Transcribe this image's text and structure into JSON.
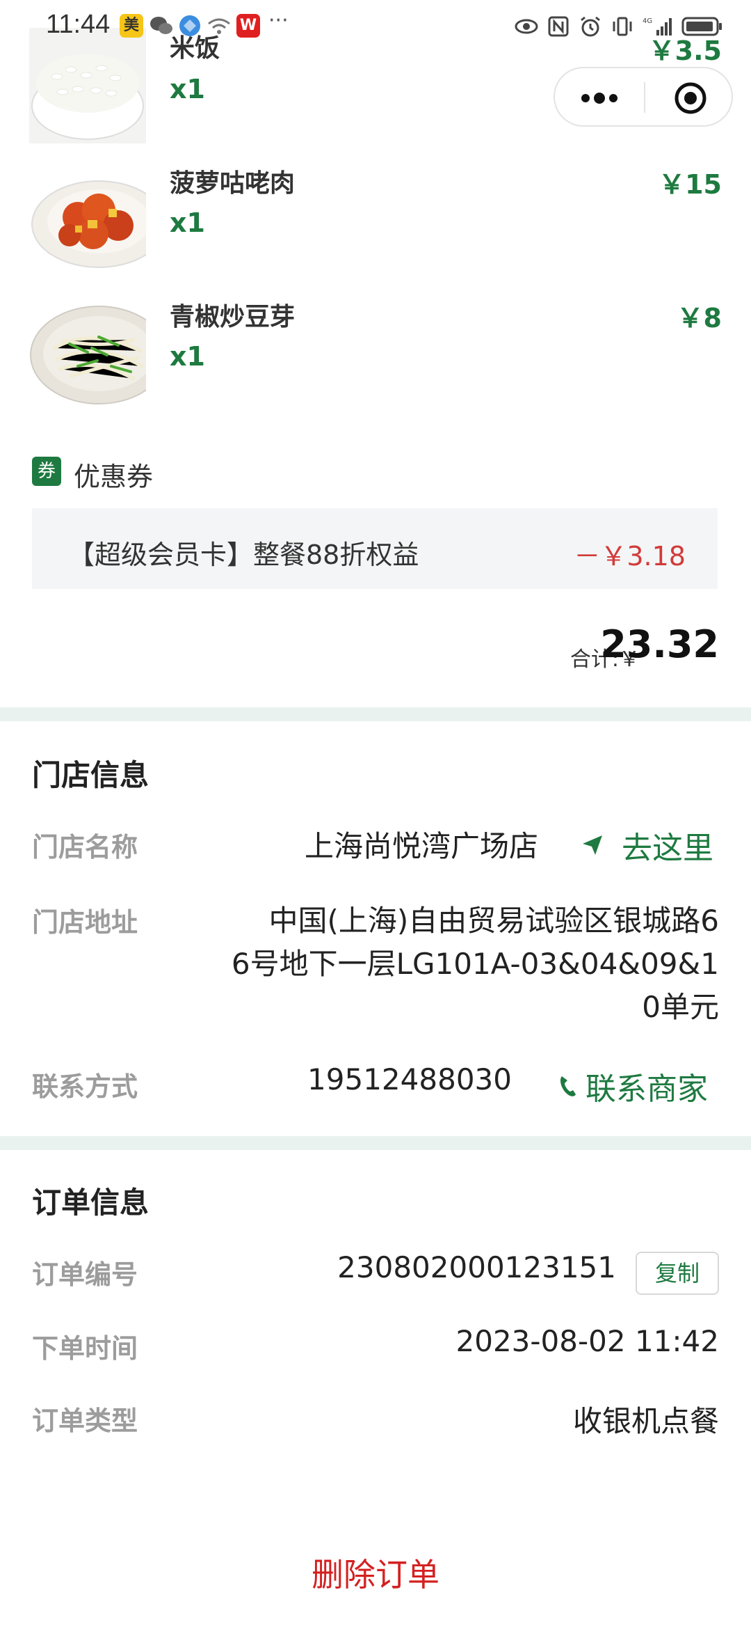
{
  "status_bar": {
    "time": "11:44",
    "app_badge_1": "美",
    "app_badge_2": "W",
    "more": "···",
    "network": "4G"
  },
  "items": [
    {
      "name": "米饭",
      "qty": "x1",
      "price": "￥3.5"
    },
    {
      "name": "菠萝咕咾肉",
      "qty": "x1",
      "price": "￥15"
    },
    {
      "name": "青椒炒豆芽",
      "qty": "x1",
      "price": "￥8"
    }
  ],
  "coupon": {
    "tag": "券",
    "title": "优惠券",
    "text": "【超级会员卡】整餐88折权益",
    "amount": "－￥3.18"
  },
  "total": {
    "label": "合计:￥",
    "value": "23.32"
  },
  "store": {
    "section_title": "门店信息",
    "name_label": "门店名称",
    "name_value": "上海尚悦湾广场店",
    "go_label": "去这里",
    "address_label": "门店地址",
    "address_lines": [
      "中国(上海)自由贸易试验区银城路6",
      "6号地下一层LG101A-03&04&09&1",
      "0单元"
    ],
    "contact_label": "联系方式",
    "contact_value": "19512488030",
    "contact_link": "联系商家"
  },
  "order": {
    "section_title": "订单信息",
    "number_label": "订单编号",
    "number_value": "230802000123151",
    "copy_label": "复制",
    "time_label": "下单时间",
    "time_value": "2023-08-02 11:42",
    "type_label": "订单类型",
    "type_value": "收银机点餐"
  },
  "delete_label": "删除订单",
  "colors": {
    "green": "#1e7a40",
    "red": "#d42020",
    "band": "#e9f2ef"
  }
}
